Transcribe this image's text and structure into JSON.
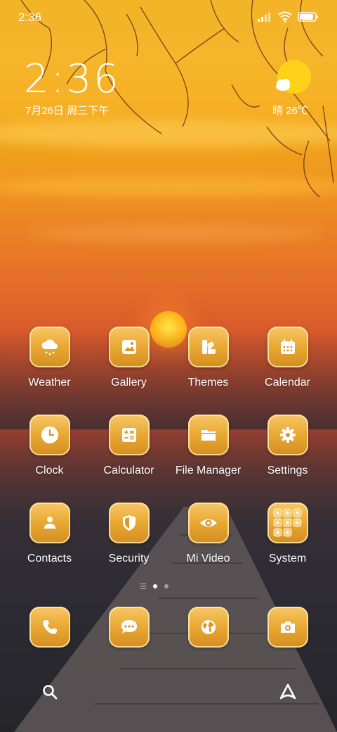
{
  "status_bar": {
    "time": "2:36",
    "battery_level": 0.9
  },
  "widget": {
    "clock": "2:36",
    "date": "7月26日 周三下午",
    "weather": "晴 26℃"
  },
  "apps": [
    {
      "label": "Weather",
      "icon": "cloud-rain-icon"
    },
    {
      "label": "Gallery",
      "icon": "image-icon"
    },
    {
      "label": "Themes",
      "icon": "themes-icon"
    },
    {
      "label": "Calendar",
      "icon": "calendar-icon"
    },
    {
      "label": "Clock",
      "icon": "clock-icon"
    },
    {
      "label": "Calculator",
      "icon": "calculator-icon"
    },
    {
      "label": "File Manager",
      "icon": "folder-icon"
    },
    {
      "label": "Settings",
      "icon": "gear-icon"
    },
    {
      "label": "Contacts",
      "icon": "person-icon"
    },
    {
      "label": "Security",
      "icon": "shield-icon"
    },
    {
      "label": "Mi Video",
      "icon": "eye-icon"
    },
    {
      "label": "System",
      "icon": "folder-grid-icon"
    }
  ],
  "page_indicator": {
    "pages": 3,
    "current": 2
  },
  "dock": [
    "phone-icon",
    "chat-icon",
    "browser-icon",
    "camera-icon"
  ],
  "colors": {
    "icon_fill": "#e8a833",
    "glyph": "#ffffff"
  }
}
